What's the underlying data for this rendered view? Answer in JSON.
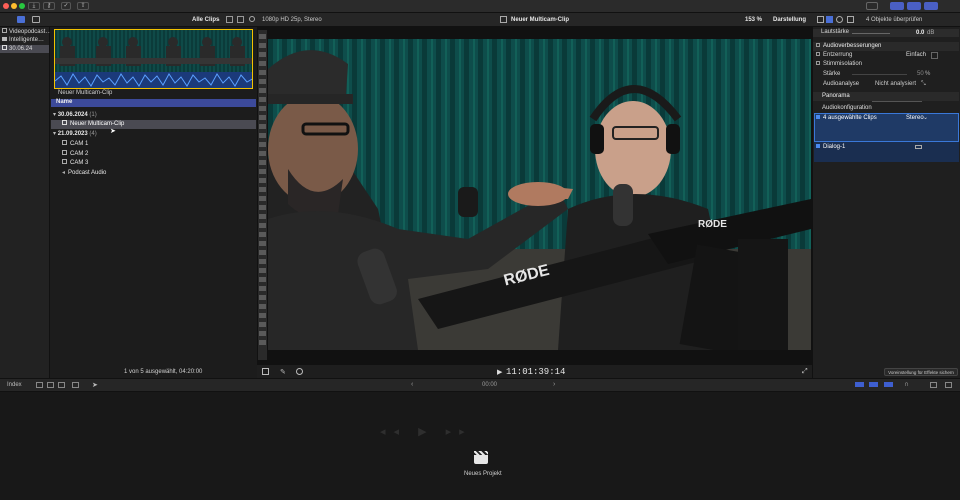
{
  "toolbar": {
    "traffic": [
      "#ff5f57",
      "#febc2e",
      "#28c840"
    ],
    "view_title": "Alle Clips",
    "format_label": "1080p HD 25p, Stereo",
    "project_title": "Neuer Multicam-Clip",
    "zoom": "153 %",
    "display_label": "Darstellung",
    "inspector_count": "4 Objekte überprüfen"
  },
  "library": {
    "items": [
      {
        "label": "Videopodcast…"
      },
      {
        "label": "Intelligente…"
      },
      {
        "label": "30.06.24"
      }
    ]
  },
  "browser": {
    "filmstrip_caption": "Neuer Multicam-Clip",
    "column_header": "Name",
    "groups": [
      {
        "date": "30.06.2024",
        "count": "(1)",
        "items": [
          {
            "label": "Neuer Multicam-Clip"
          }
        ]
      },
      {
        "date": "21.09.2023",
        "count": "(4)",
        "items": [
          {
            "label": "CAM 1"
          },
          {
            "label": "CAM 2"
          },
          {
            "label": "CAM 3"
          },
          {
            "label": "Podcast Audio"
          }
        ]
      }
    ],
    "status": "1 von 5 ausgewählt, 04:20:00"
  },
  "viewer": {
    "timecode": "11:01:39:14",
    "mic_brand": "RØDE"
  },
  "inspector": {
    "volume_label": "Lautstärke",
    "volume_value": "0.0",
    "volume_unit": "dB",
    "enhancements_header": "Audioverbesserungen",
    "denoise_label": "Entzerrung",
    "denoise_value": "Einfach",
    "voice_isolation_label": "Stimmisolation",
    "strength_label": "Stärke",
    "strength_value": "50",
    "strength_unit": "%",
    "analysis_label": "Audioanalyse",
    "analysis_value": "Nicht analysiert",
    "pan_label": "Panorama",
    "config_label": "Audiokonfiguration",
    "selected_clips_label": "4 ausgewählte Clips",
    "selected_clips_mode": "Stereo",
    "dialog_label": "Dialog-1",
    "effects_preset": "Voreinstellung für Effekte sichern"
  },
  "timeline": {
    "index_label": "Index",
    "time_display": "00:00",
    "empty_project_label": "Neues Projekt"
  }
}
